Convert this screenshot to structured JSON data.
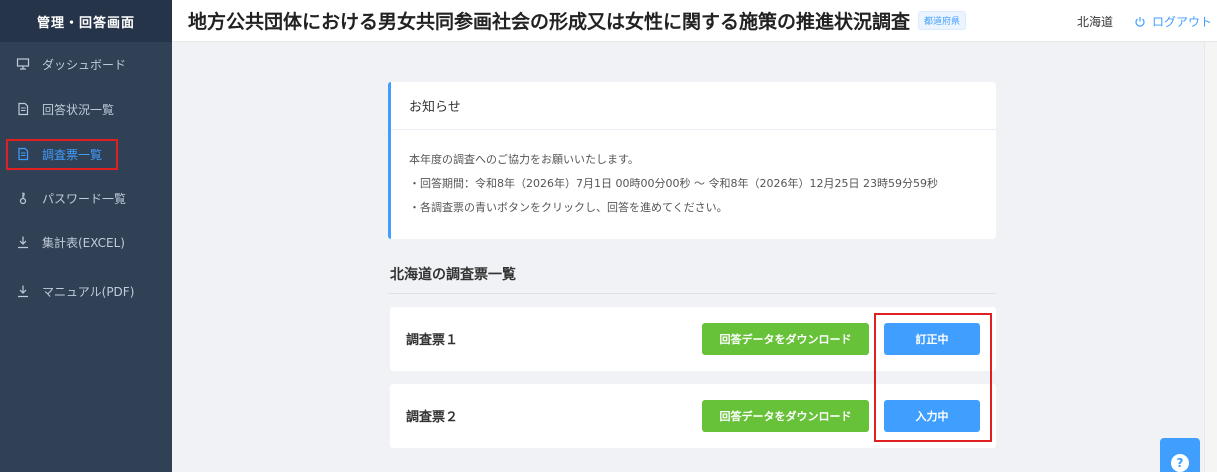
{
  "sidebar": {
    "title": "管理・回答画面",
    "items": [
      {
        "label": "ダッシュボード",
        "icon": "dashboard-icon"
      },
      {
        "label": "回答状況一覧",
        "icon": "document-icon"
      },
      {
        "label": "調査票一覧",
        "icon": "document-icon",
        "active": true
      },
      {
        "label": "パスワード一覧",
        "icon": "key-icon"
      },
      {
        "label": "集計表(EXCEL)",
        "icon": "download-icon"
      },
      {
        "label": "マニュアル(PDF)",
        "icon": "download-icon"
      }
    ]
  },
  "header": {
    "title": "地方公共団体における男女共同参画社会の形成又は女性に関する施策の推進状況調査",
    "tag": "都道府県",
    "user": "北海道",
    "logout": "ログアウト"
  },
  "notice": {
    "title": "お知らせ",
    "lines": [
      "本年度の調査へのご協力をお願いいたします。",
      "・回答期間：令和8年（2026年）7月1日 00時00分00秒 〜 令和8年（2026年）12月25日 23時59分59秒",
      "・各調査票の青いボタンをクリックし、回答を進めてください。"
    ]
  },
  "survey_list": {
    "title": "北海道の調査票一覧",
    "items": [
      {
        "name": "調査票１",
        "download_label": "回答データをダウンロード",
        "status_label": "訂正中"
      },
      {
        "name": "調査票２",
        "download_label": "回答データをダウンロード",
        "status_label": "入力中"
      }
    ]
  },
  "help": {
    "label": "?"
  },
  "colors": {
    "sidebar": "#304156",
    "accent": "#409eff",
    "green": "#67c23a",
    "highlight": "#e02020"
  }
}
